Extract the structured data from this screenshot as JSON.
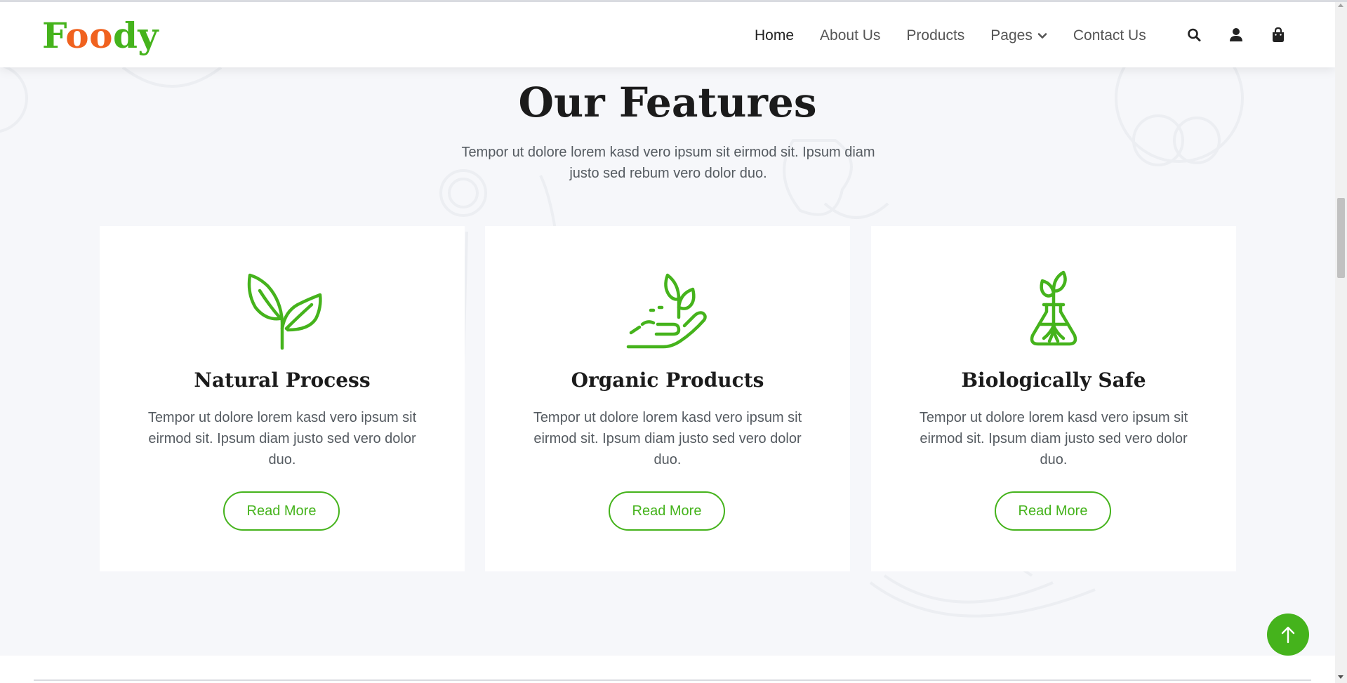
{
  "brand": {
    "part1": "F",
    "part2": "oo",
    "part3": "dy"
  },
  "colors": {
    "accent": "#45b31c",
    "brand_orange": "#f0621f",
    "background": "#f6f7fa"
  },
  "nav": {
    "items": [
      {
        "label": "Home",
        "active": true
      },
      {
        "label": "About Us",
        "active": false
      },
      {
        "label": "Products",
        "active": false
      },
      {
        "label": "Pages",
        "active": false,
        "dropdown": true
      },
      {
        "label": "Contact Us",
        "active": false
      }
    ],
    "icons": [
      "search-icon",
      "user-icon",
      "shopping-bag-icon"
    ]
  },
  "features": {
    "title": "Our Features",
    "subtitle": "Tempor ut dolore lorem kasd vero ipsum sit eirmod sit. Ipsum diam justo sed rebum vero dolor duo.",
    "cards": [
      {
        "icon": "sprout-icon",
        "title": "Natural Process",
        "text": "Tempor ut dolore lorem kasd vero ipsum sit eirmod sit. Ipsum diam justo sed vero dolor duo.",
        "button": "Read More"
      },
      {
        "icon": "hand-plant-icon",
        "title": "Organic Products",
        "text": "Tempor ut dolore lorem kasd vero ipsum sit eirmod sit. Ipsum diam justo sed vero dolor duo.",
        "button": "Read More"
      },
      {
        "icon": "flask-plant-icon",
        "title": "Biologically Safe",
        "text": "Tempor ut dolore lorem kasd vero ipsum sit eirmod sit. Ipsum diam justo sed vero dolor duo.",
        "button": "Read More"
      }
    ]
  },
  "back_to_top": {
    "icon": "arrow-up-icon"
  }
}
